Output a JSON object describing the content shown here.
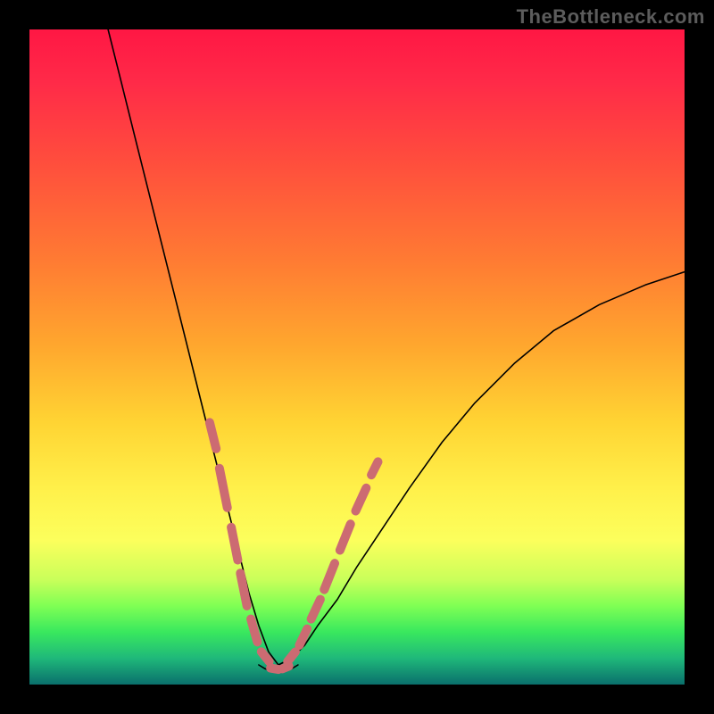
{
  "watermark": "TheBottleneck.com",
  "chart_data": {
    "type": "line",
    "title": "",
    "xlabel": "",
    "ylabel": "",
    "xlim": [
      0,
      100
    ],
    "ylim": [
      0,
      100
    ],
    "left_curve": {
      "x": [
        12,
        14,
        16,
        18,
        20,
        22,
        24,
        26,
        28,
        30,
        32,
        33.5,
        35,
        36.5,
        38
      ],
      "y": [
        100,
        92,
        84,
        76,
        68,
        60,
        52,
        44,
        36,
        28,
        20,
        14,
        9,
        5,
        3
      ]
    },
    "right_curve": {
      "x": [
        38,
        40,
        42,
        44,
        47,
        50,
        54,
        58,
        63,
        68,
        74,
        80,
        87,
        94,
        100
      ],
      "y": [
        3,
        4,
        6,
        9,
        13,
        18,
        24,
        30,
        37,
        43,
        49,
        54,
        58,
        61,
        63
      ]
    },
    "valley_floor": {
      "x": [
        35,
        36,
        37,
        38,
        39,
        40,
        41
      ],
      "y": [
        3,
        2.4,
        2.1,
        2,
        2.1,
        2.4,
        3
      ]
    },
    "dashed_overlay_left": {
      "note": "thick salmon dashed segments hugging lower-left limb",
      "segments": [
        {
          "x": [
            27.5,
            28.5
          ],
          "y": [
            40,
            36
          ]
        },
        {
          "x": [
            29,
            30.2
          ],
          "y": [
            33,
            27
          ]
        },
        {
          "x": [
            30.8,
            31.8
          ],
          "y": [
            24,
            19
          ]
        },
        {
          "x": [
            32.2,
            33.2
          ],
          "y": [
            17,
            12
          ]
        },
        {
          "x": [
            33.8,
            34.8
          ],
          "y": [
            10,
            6.5
          ]
        },
        {
          "x": [
            35.4,
            36.6
          ],
          "y": [
            5,
            3.5
          ]
        }
      ]
    },
    "dashed_overlay_right": {
      "note": "thick salmon dashed segments hugging lower-right limb",
      "segments": [
        {
          "x": [
            39.4,
            40.6
          ],
          "y": [
            3.5,
            5
          ]
        },
        {
          "x": [
            41.2,
            42.4
          ],
          "y": [
            6,
            8.5
          ]
        },
        {
          "x": [
            43,
            44.4
          ],
          "y": [
            10,
            13
          ]
        },
        {
          "x": [
            45,
            46.6
          ],
          "y": [
            14.5,
            18.5
          ]
        },
        {
          "x": [
            47.4,
            49
          ],
          "y": [
            20.5,
            24.5
          ]
        },
        {
          "x": [
            49.8,
            51.4
          ],
          "y": [
            26.5,
            30
          ]
        },
        {
          "x": [
            52.2,
            53.2
          ],
          "y": [
            32,
            34
          ]
        }
      ]
    },
    "dashed_overlay_floor": {
      "segments": [
        {
          "x": [
            36.8,
            38.0
          ],
          "y": [
            2.5,
            2.3
          ]
        },
        {
          "x": [
            38.6,
            39.6
          ],
          "y": [
            2.4,
            2.8
          ]
        }
      ]
    },
    "colors": {
      "curve": "#000000",
      "dash": "#cc6b72",
      "background_top": "#ff1744",
      "background_bottom": "#0a6f6c"
    }
  }
}
